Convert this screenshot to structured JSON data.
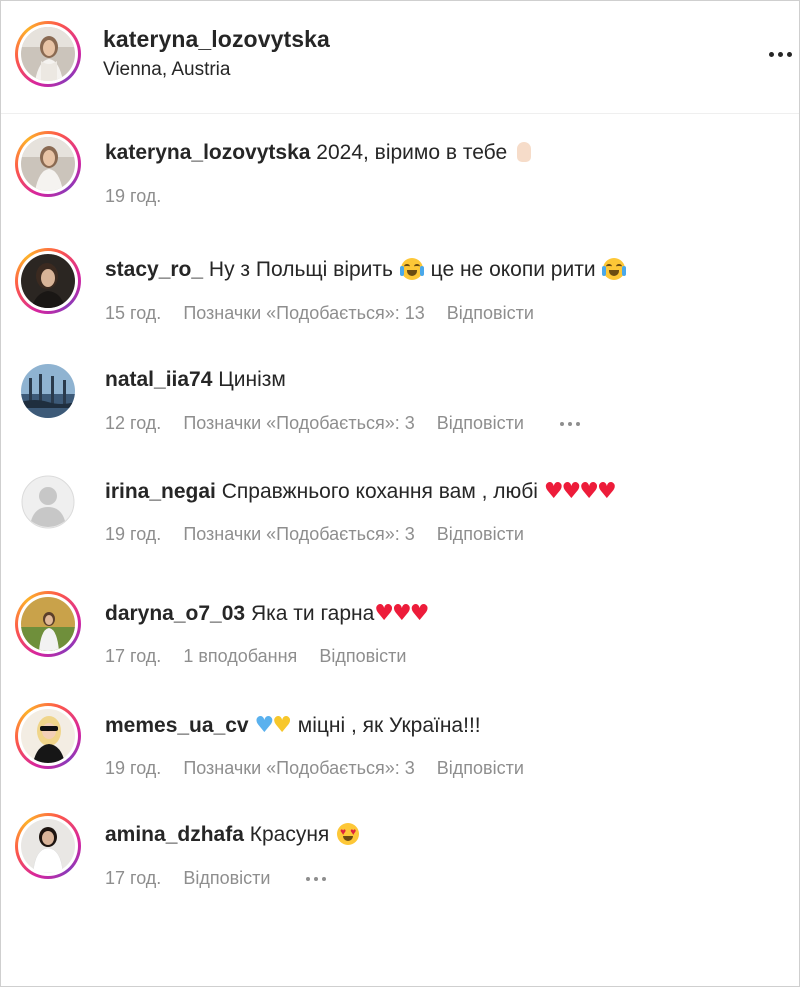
{
  "post": {
    "username": "kateryna_lozovytska",
    "location": "Vienna, Austria",
    "more_icon": "more-horizontal-icon"
  },
  "comments": [
    {
      "username": "kateryna_lozovytska",
      "text": "2024, віримо в тебе",
      "emoji": "hand-icon",
      "time": "19 год.",
      "likes": "",
      "reply": "",
      "avatar_ring": true
    },
    {
      "username": "stacy_ro_",
      "text_a": "Ну з Польщі вірить",
      "text_b": "це не окопи рити",
      "time": "15 год.",
      "likes": "Позначки «Подобається»: 13",
      "reply": "Відповісти",
      "avatar_ring": true
    },
    {
      "username": "natal_iia74",
      "text": "Цинізм",
      "time": "12 год.",
      "likes": "Позначки «Подобається»: 3",
      "reply": "Відповісти",
      "avatar_ring": false
    },
    {
      "username": "irina_negai",
      "text": "Справжнього кохання вам , любі",
      "hearts": "♥♥♥♥",
      "time": "19 год.",
      "likes": "Позначки «Подобається»: 3",
      "reply": "Відповісти",
      "avatar_ring": false
    },
    {
      "username": "daryna_o7_03",
      "text": "Яка ти гарна",
      "hearts": "♥♥♥",
      "time": "17 год.",
      "likes": "1 вподобання",
      "reply": "Відповісти",
      "avatar_ring": true
    },
    {
      "username": "memes_ua_cv",
      "blue_heart": "♥",
      "yellow_heart": "♥",
      "text": "міцні , як Україна!!!",
      "time": "19 год.",
      "likes": "Позначки «Подобається»: 3",
      "reply": "Відповісти",
      "avatar_ring": true
    },
    {
      "username": "amina_dzhafa",
      "text": "Красуня",
      "time": "17 год.",
      "likes": "",
      "reply": "Відповісти",
      "avatar_ring": true
    }
  ],
  "colors": {
    "text": "#262626",
    "muted": "#8e8e8e",
    "heart_red": "#ed1c3a",
    "heart_blue": "#5ab1ee",
    "heart_yellow": "#f7c72b"
  }
}
